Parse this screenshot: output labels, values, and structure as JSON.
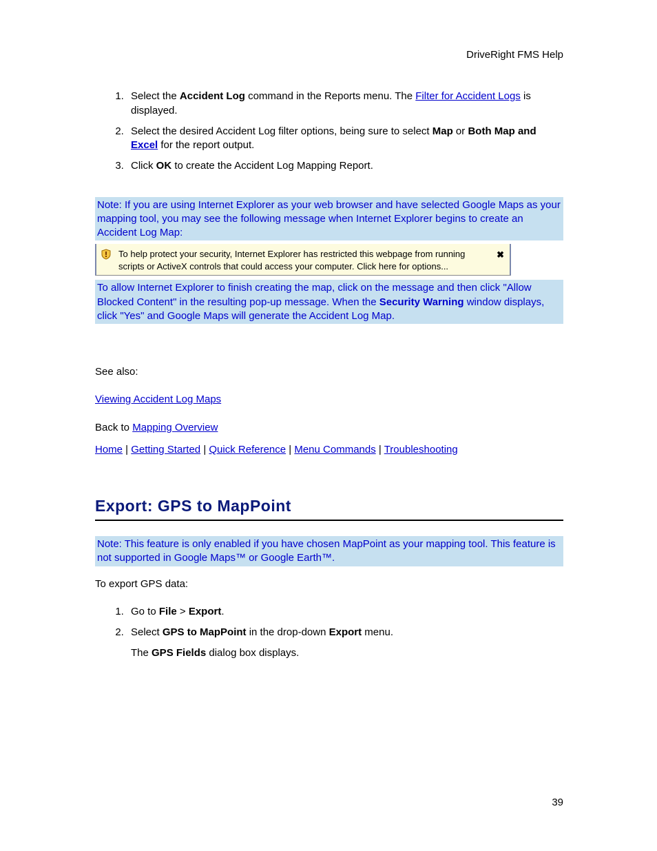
{
  "header": {
    "title": "DriveRight FMS Help"
  },
  "steps1": {
    "s1a": "Select the ",
    "s1b": "Accident Log",
    "s1c": " command in the Reports menu. The ",
    "s1link": "Filter for Accident Logs",
    "s1d": " is displayed.",
    "s2a": "Select the desired Accident Log filter options, being sure to select ",
    "s2b": "Map",
    "s2c": " or ",
    "s2d": "Both Map and ",
    "s2elink": "Excel",
    "s2f": " for the report output.",
    "s3a": "Click ",
    "s3b": "OK",
    "s3c": " to create the Accident Log Mapping Report."
  },
  "note1": "Note: If you are using Internet Explorer as your web browser and have selected Google Maps as your mapping tool, you may see the following message when Internet Explorer begins to create an Accident Log Map:",
  "iebar": {
    "text": "To help protect your security, Internet Explorer has restricted this webpage from running scripts or ActiveX controls that could access your computer. Click here for options...",
    "close": "✖"
  },
  "note2a": "To allow Internet Explorer to finish creating the map, click on the message and then click \"Allow Blocked Content\" in the resulting pop-up message. When the ",
  "note2b": "Security Warning",
  "note2c": " window displays, click \"Yes\" and Google Maps will generate the Accident Log Map.",
  "seealso": {
    "label": "See also:",
    "link1": "Viewing Accident Log Maps",
    "back": "Back to ",
    "backlink": "Mapping Overview",
    "nav": {
      "home": "Home",
      "sep": " | ",
      "gs": "Getting Started",
      "qr": "Quick Reference",
      "mc": "Menu Commands",
      "tr": "Troubleshooting"
    }
  },
  "section2": {
    "heading": "Export: GPS to MapPoint",
    "note": "Note: This feature is only enabled if you have chosen MapPoint as your mapping tool. This feature is not supported in Google Maps™ or Google Earth™.",
    "intro": "To export GPS data:",
    "s1a": "Go to ",
    "s1b": "File",
    "s1c": " > ",
    "s1d": "Export",
    "s1e": ".",
    "s2a": " Select ",
    "s2b": "GPS to MapPoint",
    "s2c": " in the drop-down ",
    "s2d": "Export",
    "s2e": " menu.",
    "s3a": "The ",
    "s3b": "GPS Fields",
    "s3c": " dialog box displays."
  },
  "pagenum": "39"
}
